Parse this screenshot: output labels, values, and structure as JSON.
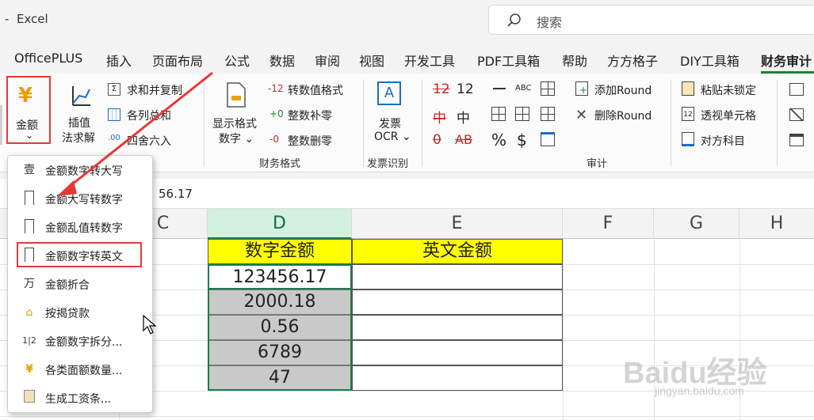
{
  "window": {
    "title": "-  Excel"
  },
  "search": {
    "placeholder": "搜索"
  },
  "tabs": [
    "OfficePLUS",
    "插入",
    "页面布局",
    "公式",
    "数据",
    "审阅",
    "视图",
    "开发工具",
    "PDF工具箱",
    "帮助",
    "方方格子",
    "DIY工具箱",
    "财务审计"
  ],
  "ribbon": {
    "amount_button": {
      "label": "金额",
      "arrow": "⌄"
    },
    "interp": {
      "line1": "插值",
      "line2": "法求解"
    },
    "qiuhe": "求和并复制",
    "gelie": "各列总和",
    "sishe": "四舍六入",
    "display_format": {
      "line1": "显示格式",
      "line2": "数字 ⌄"
    },
    "zhuanshuzhi": "转数值格式",
    "zhuanshuzhi_icon": "-12",
    "zhengshubuling": "整数补零",
    "zhengshubuling_icon": "+0",
    "zhengshushanling": "整数删零",
    "zhengshushanling_icon": "-0",
    "group_finance_format": "财务格式",
    "invoice": {
      "line1": "发票",
      "line2": "OCR ⌄"
    },
    "group_invoice": "发票识别",
    "glyph_12": "12",
    "glyph_12_red": "12",
    "glyph_zhong": "中",
    "glyph_zhong_red": "中",
    "glyph_ab_red": "AB",
    "glyph_abc": "ABC",
    "glyph_zero_red": "0",
    "glyph_percent": "%",
    "glyph_dollar": "$",
    "add_round": "添加Round",
    "del_round": "删除Round",
    "group_audit": "审计",
    "paste_unlocked": "粘贴未锁定",
    "perspective": "透视单元格",
    "opposite": "对方科目"
  },
  "formula_bar": {
    "value": "56.17"
  },
  "columns": [
    "C",
    "D",
    "E",
    "F",
    "G",
    "H"
  ],
  "table": {
    "header_d": "数字金额",
    "header_e": "英文金额",
    "values": [
      "123456.17",
      "2000.18",
      "0.56",
      "6789",
      "47"
    ]
  },
  "dropdown": {
    "items": [
      {
        "icon": "壹",
        "label": "金额数字转大写"
      },
      {
        "icon": "bookmark-icon",
        "label": "金额大写转数字"
      },
      {
        "icon": "bookmark-icon",
        "label": "金额乱值转数字"
      },
      {
        "icon": "bookmark-icon",
        "label": "金额数字转英文"
      },
      {
        "icon": "万",
        "label": "金额折合"
      },
      {
        "icon": "house-icon",
        "label": "按揭贷款"
      },
      {
        "icon": "1|2",
        "label": "金额数字拆分..."
      },
      {
        "icon": "¥",
        "label": "各类面额数量..."
      },
      {
        "icon": "doc-coin-icon",
        "label": "生成工资条..."
      }
    ]
  },
  "watermark": {
    "main": "Baidu经验",
    "sub": "jingyan.baidu.com"
  },
  "colors": {
    "accent_red": "#e53935",
    "excel_green": "#1e7b4c",
    "yellow": "#ffff00",
    "gold": "#e8a000"
  }
}
